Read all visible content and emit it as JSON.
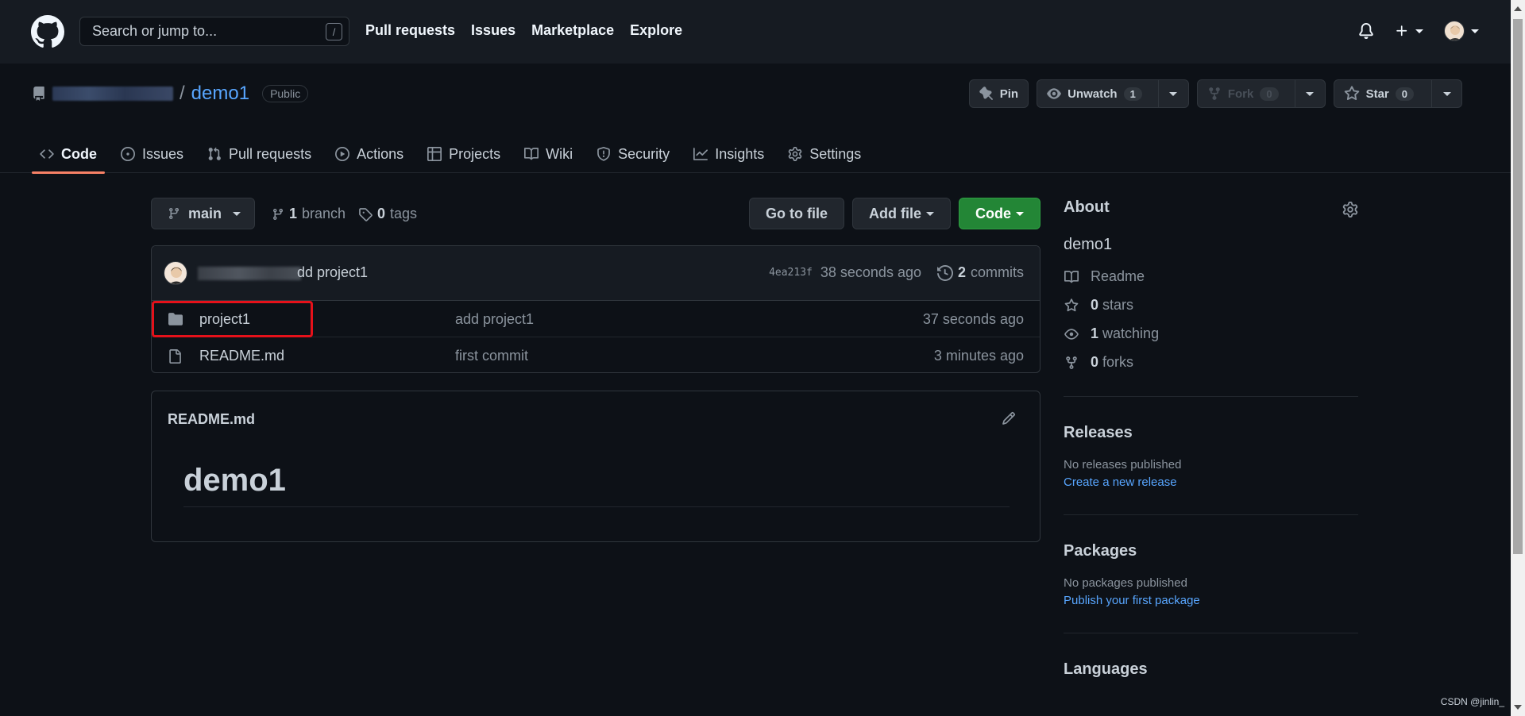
{
  "header": {
    "search_placeholder": "Search or jump to...",
    "search_shortcut": "/",
    "nav": [
      "Pull requests",
      "Issues",
      "Marketplace",
      "Explore"
    ]
  },
  "repo": {
    "separator": "/",
    "name": "demo1",
    "visibility": "Public",
    "pin_label": "Pin",
    "unwatch_label": "Unwatch",
    "watch_count": "1",
    "fork_label": "Fork",
    "fork_count": "0",
    "star_label": "Star",
    "star_count": "0"
  },
  "tabs": [
    {
      "label": "Code",
      "icon": "code-icon",
      "active": true
    },
    {
      "label": "Issues",
      "icon": "issue-icon"
    },
    {
      "label": "Pull requests",
      "icon": "pull-request-icon"
    },
    {
      "label": "Actions",
      "icon": "play-icon"
    },
    {
      "label": "Projects",
      "icon": "table-icon"
    },
    {
      "label": "Wiki",
      "icon": "book-icon"
    },
    {
      "label": "Security",
      "icon": "shield-icon"
    },
    {
      "label": "Insights",
      "icon": "graph-icon"
    },
    {
      "label": "Settings",
      "icon": "gear-icon"
    }
  ],
  "branchbar": {
    "branch": "main",
    "branch_count": "1",
    "branch_word": "branch",
    "tag_count": "0",
    "tag_word": "tags",
    "go_to_file": "Go to file",
    "add_file": "Add file",
    "code": "Code"
  },
  "latest_commit": {
    "message_visible": "dd project1",
    "sha": "4ea213f",
    "time": "38 seconds ago",
    "commit_count": "2",
    "commit_word": "commits"
  },
  "files": [
    {
      "name": "project1",
      "type": "folder",
      "message": "add project1",
      "time": "37 seconds ago"
    },
    {
      "name": "README.md",
      "type": "file",
      "message": "first commit",
      "time": "3 minutes ago"
    }
  ],
  "readme": {
    "filename": "README.md",
    "heading": "demo1"
  },
  "sidebar": {
    "about_title": "About",
    "description": "demo1",
    "readme_label": "Readme",
    "stars_count": "0",
    "stars_word": "stars",
    "watching_count": "1",
    "watching_word": "watching",
    "forks_count": "0",
    "forks_word": "forks",
    "releases_title": "Releases",
    "releases_none": "No releases published",
    "releases_link": "Create a new release",
    "packages_title": "Packages",
    "packages_none": "No packages published",
    "packages_link": "Publish your first package",
    "languages_title": "Languages"
  },
  "watermark": "CSDN @jinlin_",
  "colors": {
    "accent_link": "#58a6ff",
    "primary_button": "#238636",
    "tab_underline": "#f78166",
    "highlight_box": "#e5111a"
  }
}
